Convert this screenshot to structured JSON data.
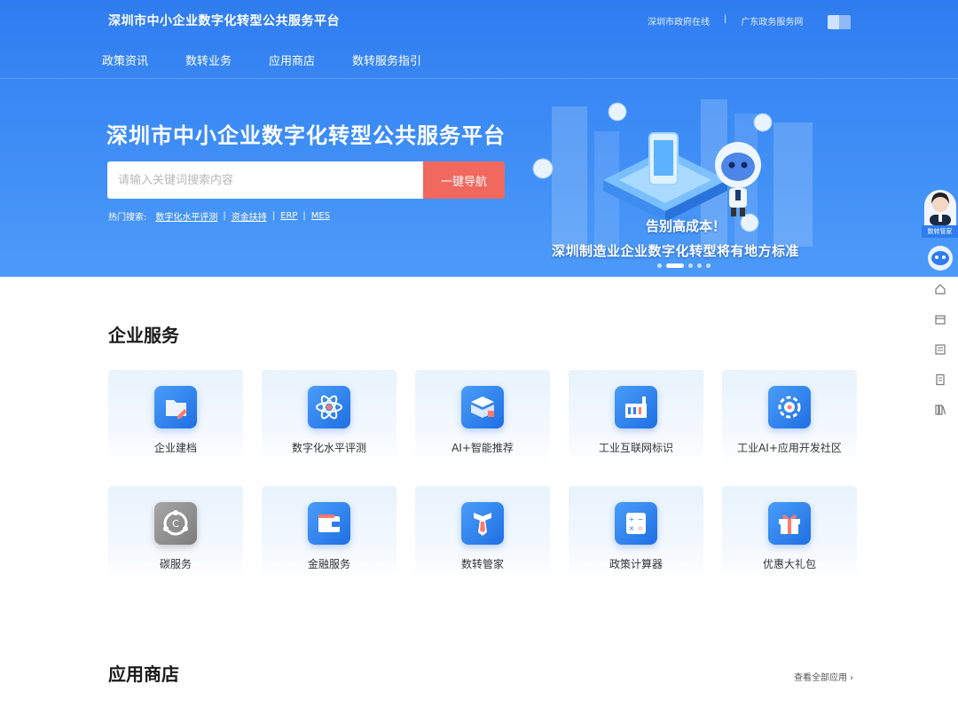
{
  "header": {
    "site_title": "深圳市中小企业数字化转型公共服务平台",
    "top_links": [
      "深圳市政府在线",
      "广东政务服务网"
    ],
    "separator": "|",
    "nav": [
      "政策资讯",
      "数转业务",
      "应用商店",
      "数转服务指引"
    ]
  },
  "banner": {
    "title": "深圳市中小企业数字化转型公共服务平台",
    "search_placeholder": "请输入关键词搜索内容",
    "search_button": "一键导航",
    "hot_label": "热门搜索:",
    "hot_links": [
      "数字化水平评测",
      "资金扶持",
      "ERP",
      "MES"
    ],
    "hot_separator": "|",
    "caption1": "告别高成本！",
    "caption2": "深圳制造业企业数字化转型将有地方标准",
    "slide_count": 5,
    "active_slide": 2
  },
  "enterprise_services": {
    "title": "企业服务",
    "items": [
      {
        "label": "企业建档",
        "icon": "folder-edit-icon"
      },
      {
        "label": "数字化水平评测",
        "icon": "atom-icon"
      },
      {
        "label": "AI+智能推荐",
        "icon": "cube-stack-icon"
      },
      {
        "label": "工业互联网标识",
        "icon": "factory-icon"
      },
      {
        "label": "工业AI+应用开发社区",
        "icon": "ai-gear-icon"
      },
      {
        "label": "碳服务",
        "icon": "carbon-gear-icon"
      },
      {
        "label": "金融服务",
        "icon": "wallet-icon"
      },
      {
        "label": "数转管家",
        "icon": "tie-icon"
      },
      {
        "label": "政策计算器",
        "icon": "calculator-icon"
      },
      {
        "label": "优惠大礼包",
        "icon": "gift-icon"
      }
    ]
  },
  "app_store": {
    "title": "应用商店",
    "view_all": "查看全部应用 ›"
  },
  "float_bar": {
    "assistant_label": "数转管家"
  },
  "colors": {
    "header_blue": "#2f7cf0",
    "search_button": "#f0685e",
    "icon_blue": "#1f6fe4"
  }
}
